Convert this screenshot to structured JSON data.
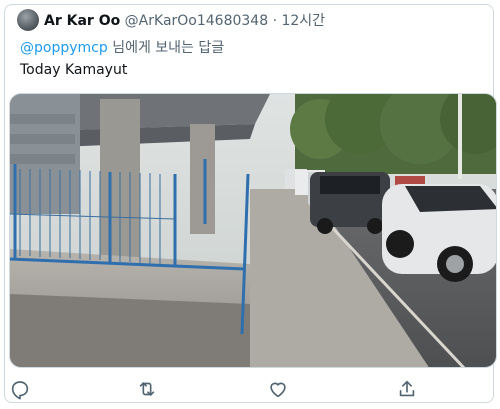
{
  "tweet": {
    "author_name": "Ar Kar Oo",
    "author_handle": "@ArKarOo14680348",
    "separator": "·",
    "time": "12시간",
    "reply_mention": "@poppymcp",
    "reply_suffix": "님에게 보내는 답글",
    "text": "Today Kamayut"
  },
  "icons": {
    "reply": "reply-icon",
    "retweet": "retweet-icon",
    "like": "like-icon",
    "share": "share-icon"
  },
  "colors": {
    "accent": "#1d9bf0",
    "secondary_text": "#536471",
    "border": "#cfd9de"
  }
}
